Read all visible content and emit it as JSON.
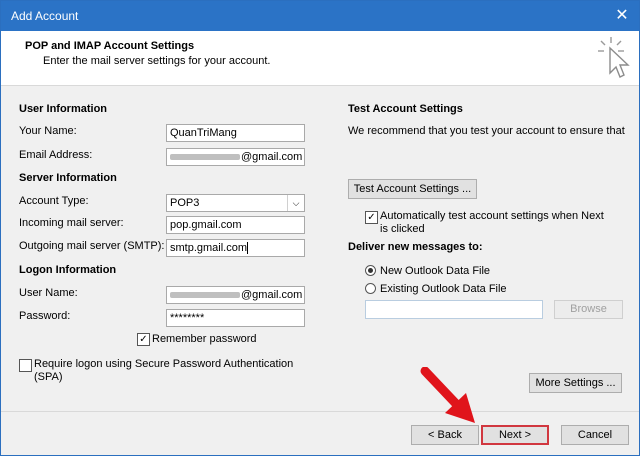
{
  "window": {
    "title": "Add Account",
    "close_glyph": "✕"
  },
  "header": {
    "title": "POP and IMAP Account Settings",
    "subtitle": "Enter the mail server settings for your account.",
    "icon": "click-cursor-icon"
  },
  "user_info": {
    "section": "User Information",
    "name_label": "Your Name:",
    "name_value": "QuanTriMang",
    "email_label": "Email Address:",
    "email_value": "@gmail.com"
  },
  "server_info": {
    "section": "Server Information",
    "type_label": "Account Type:",
    "type_value": "POP3",
    "incoming_label": "Incoming mail server:",
    "incoming_value": "pop.gmail.com",
    "outgoing_label": "Outgoing mail server (SMTP):",
    "outgoing_value": "smtp.gmail.com"
  },
  "logon_info": {
    "section": "Logon Information",
    "user_label": "User Name:",
    "user_value": "@gmail.com",
    "password_label": "Password:",
    "password_value": "********",
    "remember_label": "Remember password",
    "spa_label_1": "Require logon using Secure Password Authentication",
    "spa_label_2": "(SPA)"
  },
  "test_settings": {
    "section": "Test Account Settings",
    "description": "We recommend that you test your account to ensure that",
    "test_button": "Test Account Settings ...",
    "auto_test_1": "Automatically test account settings when Next",
    "auto_test_2": "is clicked"
  },
  "deliver": {
    "section": "Deliver new messages to:",
    "new_file": "New Outlook Data File",
    "existing_file": "Existing Outlook Data File",
    "browse": "Browse"
  },
  "buttons": {
    "more_settings": "More Settings ...",
    "back": "< Back",
    "next": "Next >",
    "cancel": "Cancel"
  },
  "colors": {
    "titlebar": "#2b73c6",
    "focus_border": "#d1373f",
    "annotation_arrow": "#e0141b"
  }
}
